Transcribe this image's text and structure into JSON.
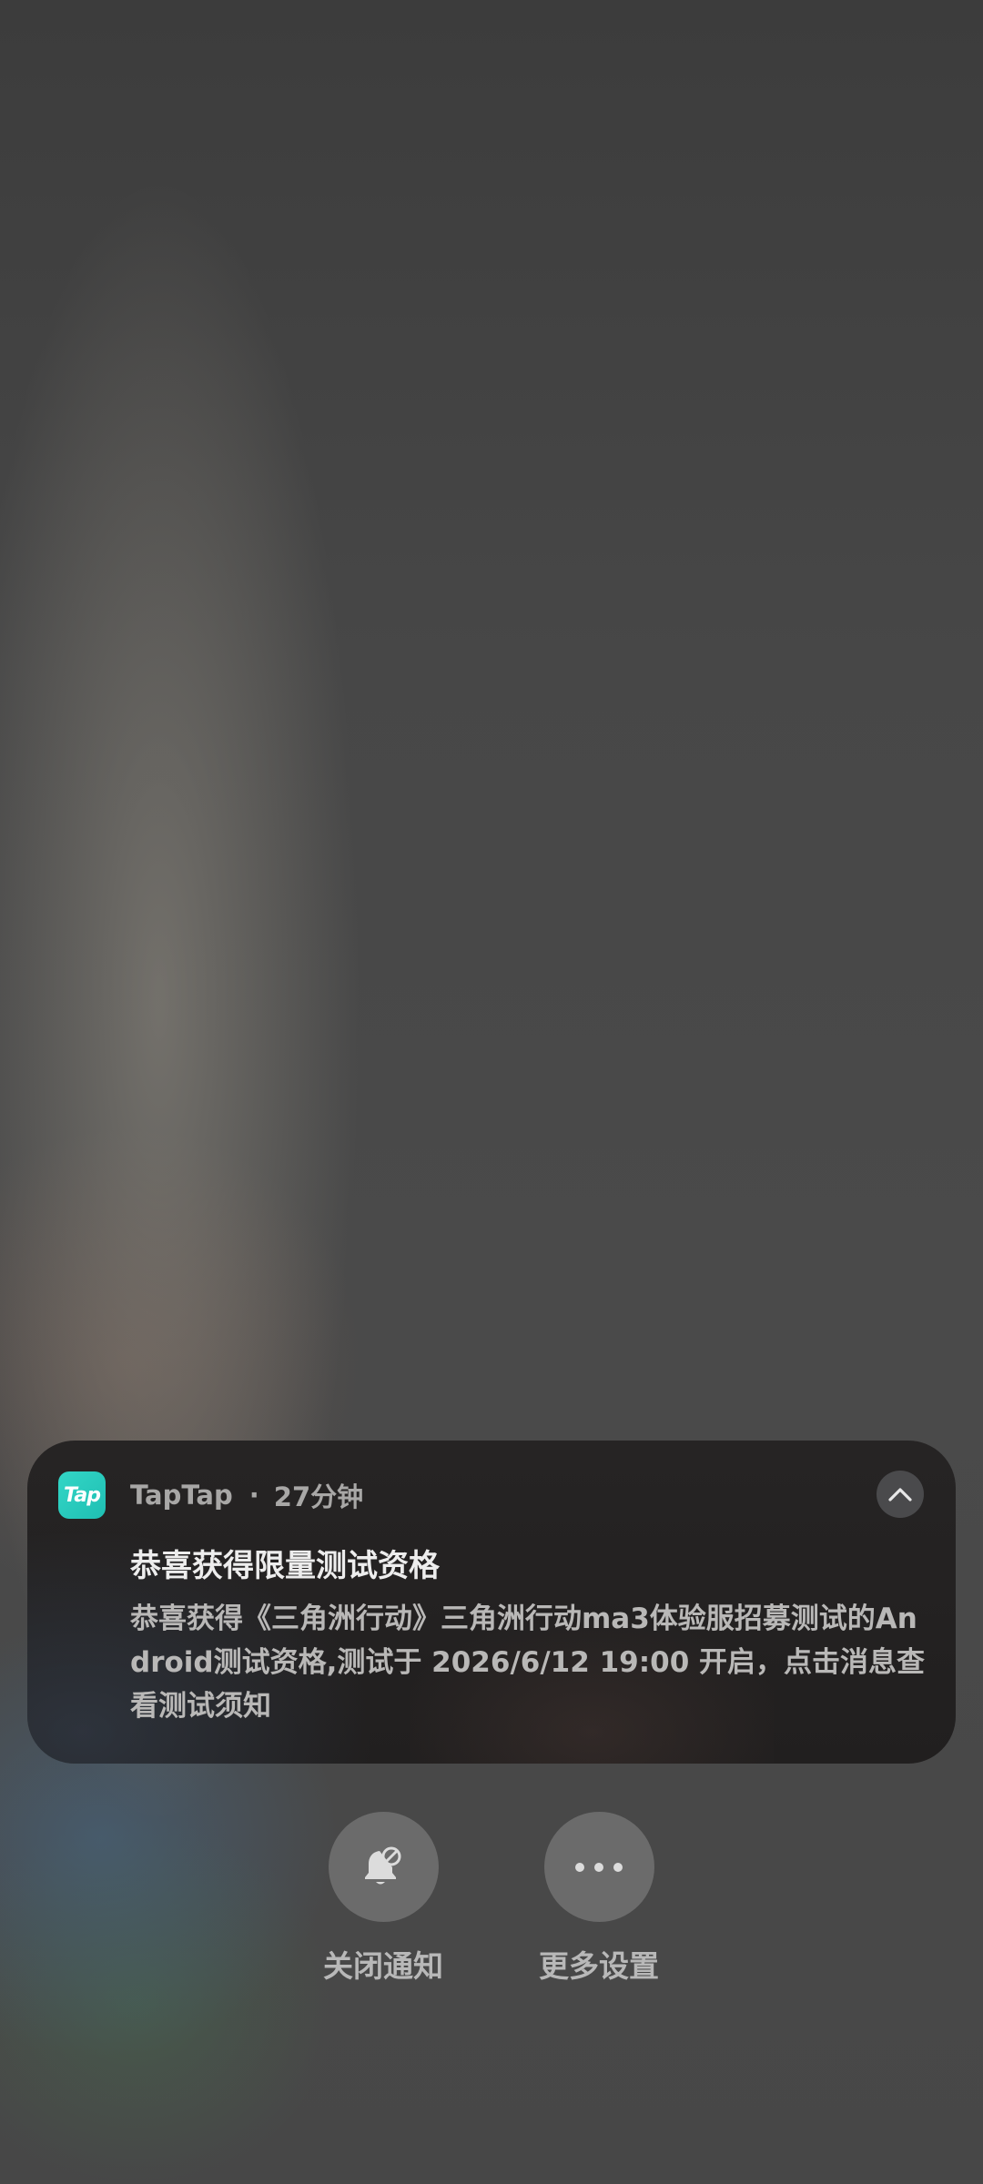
{
  "notification": {
    "app_icon_text": "Tap",
    "app_name": "TapTap",
    "separator": "·",
    "time": "27分钟",
    "title": "恭喜获得限量测试资格",
    "body": "恭喜获得《三角洲行动》三角洲行动ma3体验服招募测试的Android测试资格,测试于 2026/6/12 19:00 开启，点击消息查看测试须知",
    "collapse_icon": "chevron-up-icon",
    "accent_color": "#2ccfc1"
  },
  "actions": [
    {
      "label": "关闭通知",
      "icon": "bell-off-icon"
    },
    {
      "label": "更多设置",
      "icon": "more-dots-icon"
    }
  ]
}
